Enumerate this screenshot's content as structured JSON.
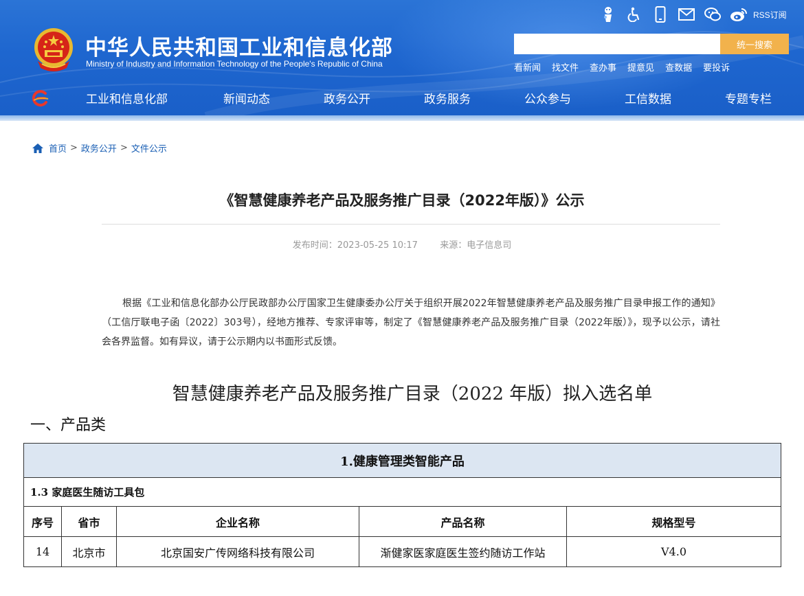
{
  "header": {
    "site_title": "中华人民共和国工业和信息化部",
    "site_subtitle": "Ministry of Industry and Information Technology of the People's Republic of China",
    "rss_label": "RSS订阅",
    "top_icons": [
      "accessibility-elder-icon",
      "wheelchair-icon",
      "mobile-icon",
      "mail-icon",
      "wechat-icon",
      "weibo-icon"
    ],
    "search": {
      "value": "",
      "placeholder": "",
      "button_label": "统一搜索"
    },
    "quick_links": [
      "看新闻",
      "找文件",
      "查办事",
      "提意见",
      "查数据",
      "要投诉"
    ],
    "colors": {
      "header_blue": "#1e66cf",
      "search_button": "#f2b24c"
    }
  },
  "nav": {
    "items": [
      "工业和信息化部",
      "新闻动态",
      "政务公开",
      "政务服务",
      "公众参与",
      "工信数据",
      "专题专栏"
    ]
  },
  "breadcrumb": {
    "items": [
      "首页",
      "政务公开",
      "文件公示"
    ],
    "separator": ">"
  },
  "article": {
    "title": "《智慧健康养老产品及服务推广目录（2022年版）》公示",
    "publish_time_label": "发布时间：2023-05-25 10:17",
    "source_label": "来源：电子信息司",
    "body": "根据《工业和信息化部办公厅民政部办公厅国家卫生健康委办公厅关于组织开展2022年智慧健康养老产品及服务推广目录申报工作的通知》（工信厅联电子函〔2022〕303号），经地方推荐、专家评审等，制定了《智慧健康养老产品及服务推广目录（2022年版）》，现予以公示，请社会各界监督。如有异议，请于公示期内以书面形式反馈。",
    "list_title": "智慧健康养老产品及服务推广目录（2022 年版）拟入选名单",
    "section_heading": "一、产品类"
  },
  "table": {
    "category": "1.健康管理类智能产品",
    "subcategory": "1.3 家庭医生随访工具包",
    "headers": [
      "序号",
      "省市",
      "企业名称",
      "产品名称",
      "规格型号"
    ],
    "rows": [
      [
        "14",
        "北京市",
        "北京国安广传网络科技有限公司",
        "渐健家医家庭医生签约随访工作站",
        "V4.0"
      ]
    ]
  }
}
